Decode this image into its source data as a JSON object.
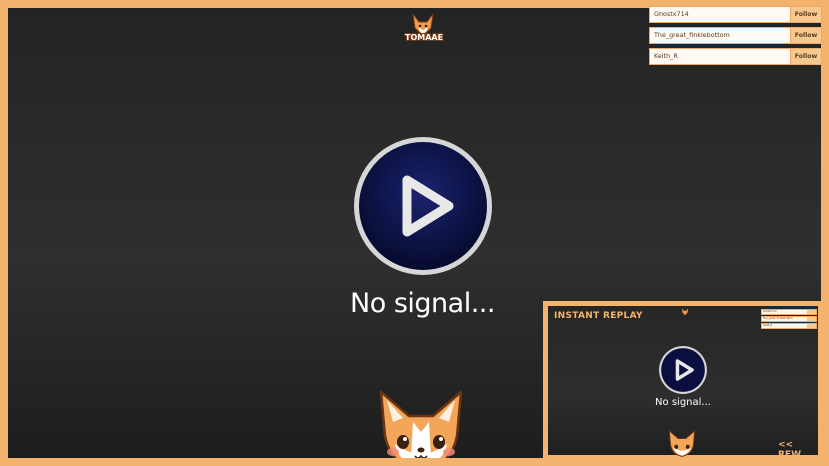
{
  "logo": {
    "text": "TOMAAE",
    "icon": "corgi-logo-icon"
  },
  "followers": [
    {
      "name": "Ghostx714",
      "action": "Follow"
    },
    {
      "name": "The_great_finklebottom",
      "action": "Follow"
    },
    {
      "name": "Keith_R",
      "action": "Follow"
    }
  ],
  "main": {
    "status_text": "No signal...",
    "play_icon": "play-icon",
    "mascot": "corgi-mascot-icon"
  },
  "instant_replay": {
    "title": "INSTANT REPLAY",
    "status_text": "No signal...",
    "rewind_label": "<< REW"
  },
  "colors": {
    "accent": "#f4b36c",
    "play_fill": "#0b0f3f",
    "background": "#2a2a2a"
  }
}
